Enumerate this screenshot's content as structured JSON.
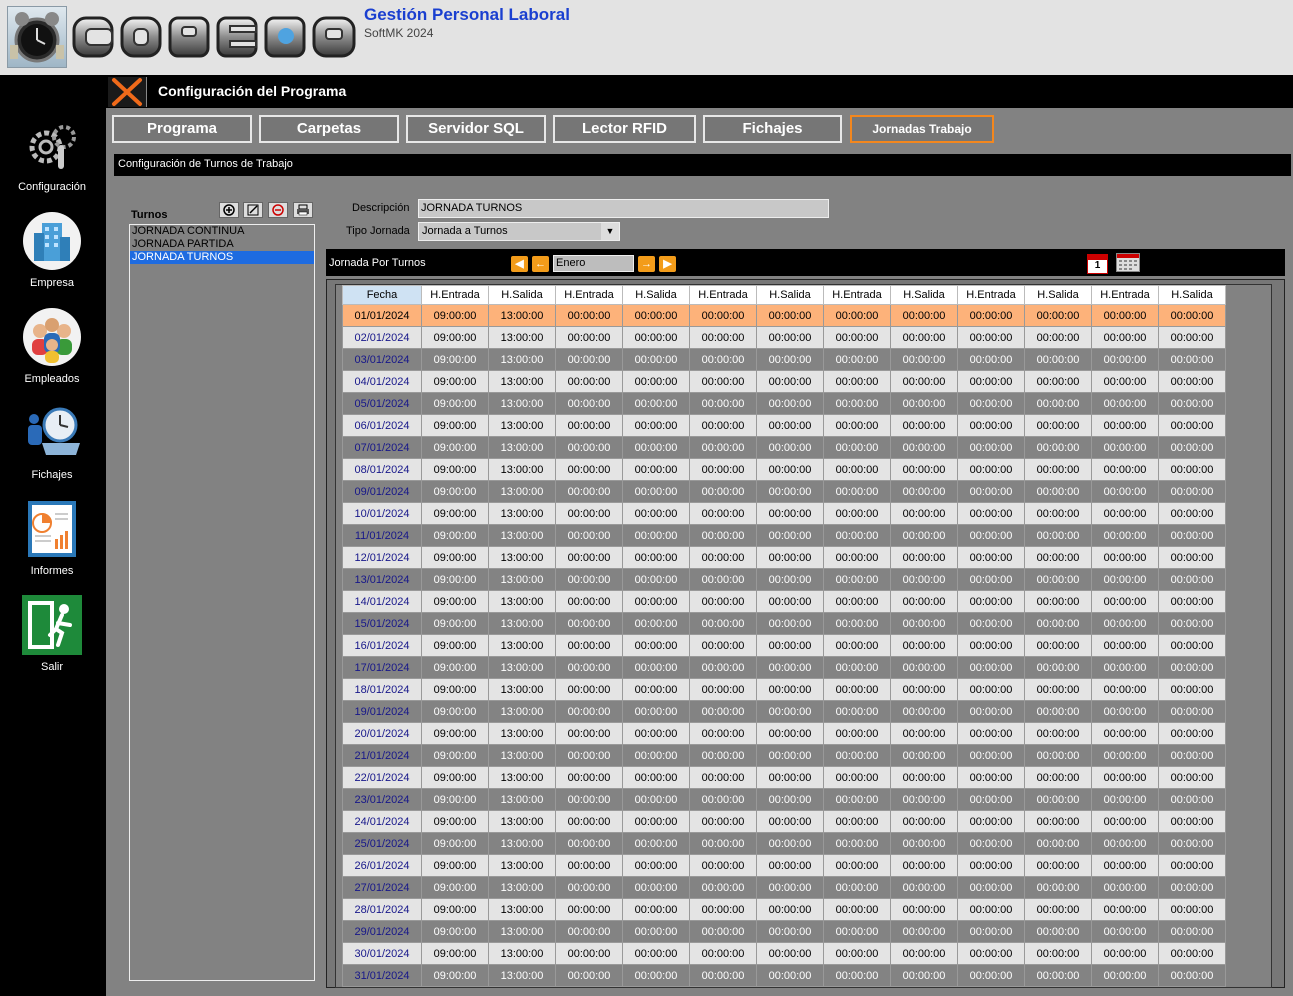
{
  "app": {
    "title": "Gestión Personal Laboral",
    "version": "SoftMK 2024",
    "logo_text": "COPELA"
  },
  "sidebar": {
    "items": [
      {
        "label": "Configuración",
        "icon": "gears-icon"
      },
      {
        "label": "Empresa",
        "icon": "building-icon"
      },
      {
        "label": "Empleados",
        "icon": "people-icon"
      },
      {
        "label": "Fichajes",
        "icon": "clock-worker-icon"
      },
      {
        "label": "Informes",
        "icon": "report-icon"
      },
      {
        "label": "Salir",
        "icon": "exit-icon"
      }
    ]
  },
  "titlebar": {
    "title": "Configuración del Programa"
  },
  "tabs": [
    "Programa",
    "Carpetas",
    "Servidor SQL",
    "Lector RFID",
    "Fichajes",
    "Jornadas Trabajo"
  ],
  "active_tab": "Jornadas Trabajo",
  "section": {
    "title": "Configuración de Turnos de Trabajo"
  },
  "turnos": {
    "label": "Turnos",
    "items": [
      "JORNADA CONTINUA",
      "JORNADA PARTIDA",
      "JORNADA TURNOS"
    ],
    "selected": "JORNADA TURNOS"
  },
  "form": {
    "descripcion_label": "Descripción",
    "descripcion_value": "JORNADA TURNOS",
    "tipo_label": "Tipo Jornada",
    "tipo_value": "Jornada a Turnos"
  },
  "jornada": {
    "label": "Jornada Por Turnos",
    "month": "Enero",
    "calendar_day": "1"
  },
  "grid": {
    "columns": [
      "Fecha",
      "H.Entrada",
      "H.Salida",
      "H.Entrada",
      "H.Salida",
      "H.Entrada",
      "H.Salida",
      "H.Entrada",
      "H.Salida",
      "H.Entrada",
      "H.Salida",
      "H.Entrada",
      "H.Salida"
    ],
    "rows": [
      [
        "01/01/2024",
        "09:00:00",
        "13:00:00",
        "00:00:00",
        "00:00:00",
        "00:00:00",
        "00:00:00",
        "00:00:00",
        "00:00:00",
        "00:00:00",
        "00:00:00",
        "00:00:00",
        "00:00:00"
      ],
      [
        "02/01/2024",
        "09:00:00",
        "13:00:00",
        "00:00:00",
        "00:00:00",
        "00:00:00",
        "00:00:00",
        "00:00:00",
        "00:00:00",
        "00:00:00",
        "00:00:00",
        "00:00:00",
        "00:00:00"
      ],
      [
        "03/01/2024",
        "09:00:00",
        "13:00:00",
        "00:00:00",
        "00:00:00",
        "00:00:00",
        "00:00:00",
        "00:00:00",
        "00:00:00",
        "00:00:00",
        "00:00:00",
        "00:00:00",
        "00:00:00"
      ],
      [
        "04/01/2024",
        "09:00:00",
        "13:00:00",
        "00:00:00",
        "00:00:00",
        "00:00:00",
        "00:00:00",
        "00:00:00",
        "00:00:00",
        "00:00:00",
        "00:00:00",
        "00:00:00",
        "00:00:00"
      ],
      [
        "05/01/2024",
        "09:00:00",
        "13:00:00",
        "00:00:00",
        "00:00:00",
        "00:00:00",
        "00:00:00",
        "00:00:00",
        "00:00:00",
        "00:00:00",
        "00:00:00",
        "00:00:00",
        "00:00:00"
      ],
      [
        "06/01/2024",
        "09:00:00",
        "13:00:00",
        "00:00:00",
        "00:00:00",
        "00:00:00",
        "00:00:00",
        "00:00:00",
        "00:00:00",
        "00:00:00",
        "00:00:00",
        "00:00:00",
        "00:00:00"
      ],
      [
        "07/01/2024",
        "09:00:00",
        "13:00:00",
        "00:00:00",
        "00:00:00",
        "00:00:00",
        "00:00:00",
        "00:00:00",
        "00:00:00",
        "00:00:00",
        "00:00:00",
        "00:00:00",
        "00:00:00"
      ],
      [
        "08/01/2024",
        "09:00:00",
        "13:00:00",
        "00:00:00",
        "00:00:00",
        "00:00:00",
        "00:00:00",
        "00:00:00",
        "00:00:00",
        "00:00:00",
        "00:00:00",
        "00:00:00",
        "00:00:00"
      ],
      [
        "09/01/2024",
        "09:00:00",
        "13:00:00",
        "00:00:00",
        "00:00:00",
        "00:00:00",
        "00:00:00",
        "00:00:00",
        "00:00:00",
        "00:00:00",
        "00:00:00",
        "00:00:00",
        "00:00:00"
      ],
      [
        "10/01/2024",
        "09:00:00",
        "13:00:00",
        "00:00:00",
        "00:00:00",
        "00:00:00",
        "00:00:00",
        "00:00:00",
        "00:00:00",
        "00:00:00",
        "00:00:00",
        "00:00:00",
        "00:00:00"
      ],
      [
        "11/01/2024",
        "09:00:00",
        "13:00:00",
        "00:00:00",
        "00:00:00",
        "00:00:00",
        "00:00:00",
        "00:00:00",
        "00:00:00",
        "00:00:00",
        "00:00:00",
        "00:00:00",
        "00:00:00"
      ],
      [
        "12/01/2024",
        "09:00:00",
        "13:00:00",
        "00:00:00",
        "00:00:00",
        "00:00:00",
        "00:00:00",
        "00:00:00",
        "00:00:00",
        "00:00:00",
        "00:00:00",
        "00:00:00",
        "00:00:00"
      ],
      [
        "13/01/2024",
        "09:00:00",
        "13:00:00",
        "00:00:00",
        "00:00:00",
        "00:00:00",
        "00:00:00",
        "00:00:00",
        "00:00:00",
        "00:00:00",
        "00:00:00",
        "00:00:00",
        "00:00:00"
      ],
      [
        "14/01/2024",
        "09:00:00",
        "13:00:00",
        "00:00:00",
        "00:00:00",
        "00:00:00",
        "00:00:00",
        "00:00:00",
        "00:00:00",
        "00:00:00",
        "00:00:00",
        "00:00:00",
        "00:00:00"
      ],
      [
        "15/01/2024",
        "09:00:00",
        "13:00:00",
        "00:00:00",
        "00:00:00",
        "00:00:00",
        "00:00:00",
        "00:00:00",
        "00:00:00",
        "00:00:00",
        "00:00:00",
        "00:00:00",
        "00:00:00"
      ],
      [
        "16/01/2024",
        "09:00:00",
        "13:00:00",
        "00:00:00",
        "00:00:00",
        "00:00:00",
        "00:00:00",
        "00:00:00",
        "00:00:00",
        "00:00:00",
        "00:00:00",
        "00:00:00",
        "00:00:00"
      ],
      [
        "17/01/2024",
        "09:00:00",
        "13:00:00",
        "00:00:00",
        "00:00:00",
        "00:00:00",
        "00:00:00",
        "00:00:00",
        "00:00:00",
        "00:00:00",
        "00:00:00",
        "00:00:00",
        "00:00:00"
      ],
      [
        "18/01/2024",
        "09:00:00",
        "13:00:00",
        "00:00:00",
        "00:00:00",
        "00:00:00",
        "00:00:00",
        "00:00:00",
        "00:00:00",
        "00:00:00",
        "00:00:00",
        "00:00:00",
        "00:00:00"
      ],
      [
        "19/01/2024",
        "09:00:00",
        "13:00:00",
        "00:00:00",
        "00:00:00",
        "00:00:00",
        "00:00:00",
        "00:00:00",
        "00:00:00",
        "00:00:00",
        "00:00:00",
        "00:00:00",
        "00:00:00"
      ],
      [
        "20/01/2024",
        "09:00:00",
        "13:00:00",
        "00:00:00",
        "00:00:00",
        "00:00:00",
        "00:00:00",
        "00:00:00",
        "00:00:00",
        "00:00:00",
        "00:00:00",
        "00:00:00",
        "00:00:00"
      ],
      [
        "21/01/2024",
        "09:00:00",
        "13:00:00",
        "00:00:00",
        "00:00:00",
        "00:00:00",
        "00:00:00",
        "00:00:00",
        "00:00:00",
        "00:00:00",
        "00:00:00",
        "00:00:00",
        "00:00:00"
      ],
      [
        "22/01/2024",
        "09:00:00",
        "13:00:00",
        "00:00:00",
        "00:00:00",
        "00:00:00",
        "00:00:00",
        "00:00:00",
        "00:00:00",
        "00:00:00",
        "00:00:00",
        "00:00:00",
        "00:00:00"
      ],
      [
        "23/01/2024",
        "09:00:00",
        "13:00:00",
        "00:00:00",
        "00:00:00",
        "00:00:00",
        "00:00:00",
        "00:00:00",
        "00:00:00",
        "00:00:00",
        "00:00:00",
        "00:00:00",
        "00:00:00"
      ],
      [
        "24/01/2024",
        "09:00:00",
        "13:00:00",
        "00:00:00",
        "00:00:00",
        "00:00:00",
        "00:00:00",
        "00:00:00",
        "00:00:00",
        "00:00:00",
        "00:00:00",
        "00:00:00",
        "00:00:00"
      ],
      [
        "25/01/2024",
        "09:00:00",
        "13:00:00",
        "00:00:00",
        "00:00:00",
        "00:00:00",
        "00:00:00",
        "00:00:00",
        "00:00:00",
        "00:00:00",
        "00:00:00",
        "00:00:00",
        "00:00:00"
      ],
      [
        "26/01/2024",
        "09:00:00",
        "13:00:00",
        "00:00:00",
        "00:00:00",
        "00:00:00",
        "00:00:00",
        "00:00:00",
        "00:00:00",
        "00:00:00",
        "00:00:00",
        "00:00:00",
        "00:00:00"
      ],
      [
        "27/01/2024",
        "09:00:00",
        "13:00:00",
        "00:00:00",
        "00:00:00",
        "00:00:00",
        "00:00:00",
        "00:00:00",
        "00:00:00",
        "00:00:00",
        "00:00:00",
        "00:00:00",
        "00:00:00"
      ],
      [
        "28/01/2024",
        "09:00:00",
        "13:00:00",
        "00:00:00",
        "00:00:00",
        "00:00:00",
        "00:00:00",
        "00:00:00",
        "00:00:00",
        "00:00:00",
        "00:00:00",
        "00:00:00",
        "00:00:00"
      ],
      [
        "29/01/2024",
        "09:00:00",
        "13:00:00",
        "00:00:00",
        "00:00:00",
        "00:00:00",
        "00:00:00",
        "00:00:00",
        "00:00:00",
        "00:00:00",
        "00:00:00",
        "00:00:00",
        "00:00:00"
      ],
      [
        "30/01/2024",
        "09:00:00",
        "13:00:00",
        "00:00:00",
        "00:00:00",
        "00:00:00",
        "00:00:00",
        "00:00:00",
        "00:00:00",
        "00:00:00",
        "00:00:00",
        "00:00:00",
        "00:00:00"
      ],
      [
        "31/01/2024",
        "09:00:00",
        "13:00:00",
        "00:00:00",
        "00:00:00",
        "00:00:00",
        "00:00:00",
        "00:00:00",
        "00:00:00",
        "00:00:00",
        "00:00:00",
        "00:00:00",
        "00:00:00"
      ]
    ],
    "selected_row": "01/01/2024"
  },
  "colors": {
    "accent": "#f3871e",
    "title_blue": "#1a3fd0",
    "selection_blue": "#1e6be0",
    "selected_row": "#fdb27a"
  }
}
